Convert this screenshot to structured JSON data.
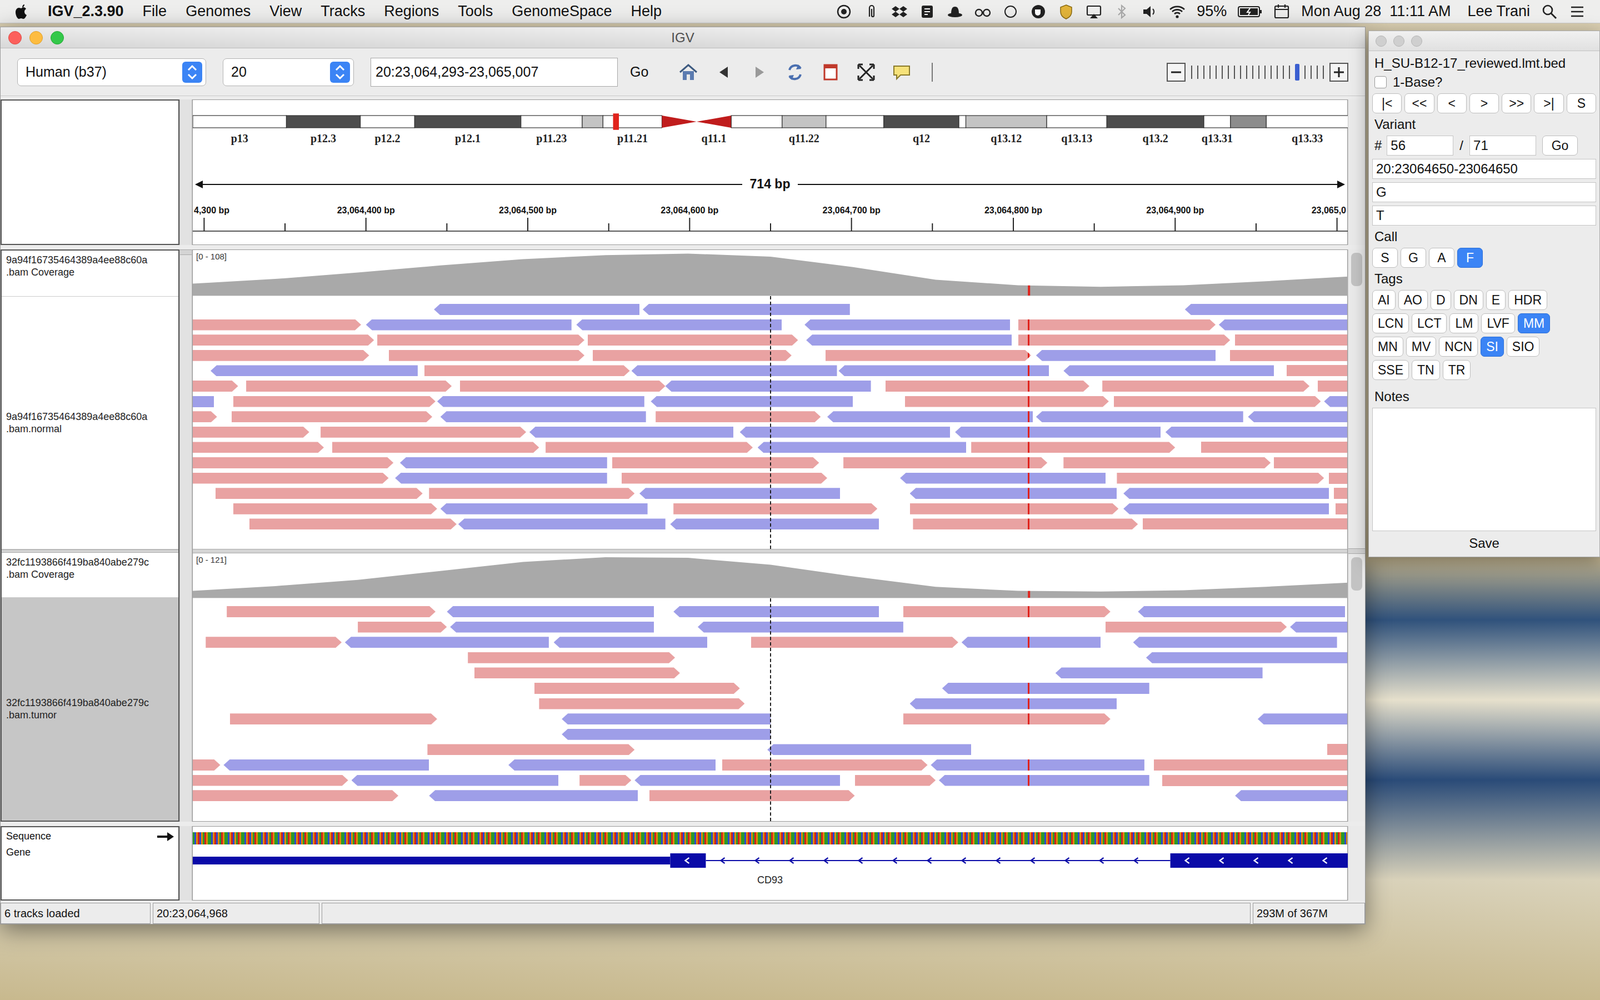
{
  "menubar": {
    "app": "IGV_2.3.90",
    "menus": [
      "File",
      "Genomes",
      "View",
      "Tracks",
      "Regions",
      "Tools",
      "GenomeSpace",
      "Help"
    ],
    "battery": "95%",
    "clock": "Mon Aug 28  11:11 AM",
    "user": "Lee Trani"
  },
  "window": {
    "title": "IGV"
  },
  "toolbar": {
    "genome": "Human (b37)",
    "chromosome": "20",
    "locus": "20:23,064,293-23,065,007",
    "go": "Go",
    "zoom": {
      "level": 0.8
    }
  },
  "ideogram": {
    "view_fraction": 0.366,
    "bands": [
      {
        "label": "p13",
        "stain": "gneg",
        "start": 0,
        "end": 0.081
      },
      {
        "label": "p12.3",
        "stain": "gpos75",
        "start": 0.081,
        "end": 0.145
      },
      {
        "label": "p12.2",
        "stain": "gneg",
        "start": 0.145,
        "end": 0.192
      },
      {
        "label": "p12.1",
        "stain": "gpos75",
        "start": 0.192,
        "end": 0.284
      },
      {
        "label": "p11.23",
        "stain": "gneg",
        "start": 0.284,
        "end": 0.337
      },
      {
        "stain": "gpos25",
        "start": 0.337,
        "end": 0.355
      },
      {
        "label": "p11.21",
        "stain": "gneg",
        "start": 0.355,
        "end": 0.406
      },
      {
        "stain": "acenp",
        "start": 0.406,
        "end": 0.436
      },
      {
        "label": "q11.1",
        "stain": "acenq",
        "start": 0.436,
        "end": 0.466
      },
      {
        "stain": "gneg",
        "start": 0.466,
        "end": 0.51
      },
      {
        "label": "q11.22",
        "stain": "gpos25",
        "start": 0.51,
        "end": 0.548
      },
      {
        "stain": "gneg",
        "start": 0.548,
        "end": 0.598
      },
      {
        "label": "q12",
        "stain": "gpos75",
        "start": 0.598,
        "end": 0.663
      },
      {
        "stain": "gneg",
        "start": 0.663,
        "end": 0.669
      },
      {
        "label": "q13.12",
        "stain": "gpos25",
        "start": 0.669,
        "end": 0.739
      },
      {
        "label": "q13.13",
        "stain": "gneg",
        "start": 0.739,
        "end": 0.791
      },
      {
        "label": "q13.2",
        "stain": "gpos75",
        "start": 0.791,
        "end": 0.875
      },
      {
        "label": "q13.31",
        "stain": "gneg",
        "start": 0.875,
        "end": 0.898
      },
      {
        "stain": "gpos50",
        "start": 0.898,
        "end": 0.929
      },
      {
        "label": "q13.33",
        "stain": "gneg",
        "start": 0.929,
        "end": 1
      }
    ]
  },
  "ruler": {
    "span": "714 bp",
    "ticks": [
      {
        "pos": 7,
        "label": "4,300 bp"
      },
      {
        "pos": 107,
        "label": "23,064,400 bp"
      },
      {
        "pos": 207,
        "label": "23,064,500 bp"
      },
      {
        "pos": 307,
        "label": "23,064,600 bp"
      },
      {
        "pos": 407,
        "label": "23,064,700 bp"
      },
      {
        "pos": 507,
        "label": "23,064,800 bp"
      },
      {
        "pos": 607,
        "label": "23,064,900 bp"
      },
      {
        "pos": 707,
        "label": "23,065,0"
      }
    ]
  },
  "view": {
    "length": 714
  },
  "tracks": [
    {
      "coverage_name": [
        "9a94f16735464389a4ee88c60a",
        ".bam Coverage"
      ],
      "reads_name": [
        "9a94f16735464389a4ee88c60a",
        ".bam.normal"
      ],
      "selected": false,
      "range": "[0 - 108]",
      "max": 108,
      "coverage": [
        30,
        42,
        58,
        76,
        92,
        102,
        106,
        98,
        72,
        40,
        26,
        22,
        26,
        36,
        48
      ],
      "rows": [
        [
          [
            149,
            276,
            "-"
          ],
          [
            278,
            406,
            "-"
          ],
          [
            613,
            714,
            "-"
          ]
        ],
        [
          [
            0,
            104,
            "+"
          ],
          [
            107,
            234,
            "-"
          ],
          [
            237,
            364,
            "-"
          ],
          [
            378,
            505,
            "-"
          ],
          [
            510,
            632,
            "+"
          ],
          [
            634,
            714,
            "-"
          ]
        ],
        [
          [
            0,
            112,
            "+"
          ],
          [
            114,
            242,
            "+"
          ],
          [
            244,
            374,
            "+"
          ],
          [
            379,
            506,
            "-"
          ],
          [
            510,
            641,
            "+"
          ],
          [
            644,
            714,
            "+"
          ]
        ],
        [
          [
            0,
            109,
            "+"
          ],
          [
            121,
            242,
            "+"
          ],
          [
            247,
            370,
            "+"
          ],
          [
            391,
            518,
            "+"
          ],
          [
            521,
            632,
            "-"
          ],
          [
            641,
            714,
            "+"
          ]
        ],
        [
          [
            11,
            139,
            "-"
          ],
          [
            143,
            270,
            "+"
          ],
          [
            271,
            398,
            "-"
          ],
          [
            399,
            529,
            "-"
          ],
          [
            538,
            668,
            "-"
          ],
          [
            676,
            714,
            "+"
          ]
        ],
        [
          [
            0,
            28,
            "+"
          ],
          [
            33,
            160,
            "+"
          ],
          [
            165,
            292,
            "+"
          ],
          [
            292,
            419,
            "-"
          ],
          [
            428,
            554,
            "+"
          ],
          [
            562,
            690,
            "+"
          ],
          [
            695,
            714,
            "+"
          ]
        ],
        [
          [
            0,
            13,
            "-"
          ],
          [
            25,
            150,
            "+"
          ],
          [
            151,
            279,
            "-"
          ],
          [
            283,
            408,
            "-"
          ],
          [
            440,
            566,
            "+"
          ],
          [
            569,
            697,
            "+"
          ],
          [
            699,
            714,
            "-"
          ]
        ],
        [
          [
            0,
            15,
            "+"
          ],
          [
            24,
            148,
            "+"
          ],
          [
            153,
            280,
            "-"
          ],
          [
            286,
            388,
            "+"
          ],
          [
            392,
            519,
            "-"
          ],
          [
            521,
            649,
            "-"
          ],
          [
            652,
            714,
            "-"
          ]
        ],
        [
          [
            0,
            72,
            "+"
          ],
          [
            79,
            206,
            "+"
          ],
          [
            208,
            334,
            "-"
          ],
          [
            338,
            468,
            "-"
          ],
          [
            471,
            598,
            "-"
          ],
          [
            601,
            714,
            "-"
          ]
        ],
        [
          [
            0,
            81,
            "+"
          ],
          [
            86,
            214,
            "+"
          ],
          [
            218,
            346,
            "+"
          ],
          [
            349,
            478,
            "-"
          ],
          [
            481,
            607,
            "+"
          ],
          [
            623,
            714,
            "+"
          ]
        ],
        [
          [
            0,
            124,
            "+"
          ],
          [
            128,
            256,
            "-"
          ],
          [
            259,
            387,
            "+"
          ],
          [
            402,
            528,
            "+"
          ],
          [
            538,
            666,
            "+"
          ],
          [
            668,
            714,
            "+"
          ]
        ],
        [
          [
            0,
            121,
            "+"
          ],
          [
            125,
            256,
            "-"
          ],
          [
            265,
            392,
            "+"
          ],
          [
            437,
            564,
            "-"
          ],
          [
            571,
            699,
            "+"
          ],
          [
            702,
            714,
            "+"
          ]
        ],
        [
          [
            14,
            142,
            "+"
          ],
          [
            146,
            273,
            "+"
          ],
          [
            276,
            400,
            "-"
          ],
          [
            443,
            571,
            "-"
          ],
          [
            575,
            702,
            "-"
          ],
          [
            705,
            714,
            "+"
          ]
        ],
        [
          [
            25,
            151,
            "+"
          ],
          [
            153,
            281,
            "-"
          ],
          [
            297,
            423,
            "+"
          ],
          [
            443,
            572,
            "+"
          ],
          [
            575,
            702,
            "-"
          ],
          [
            706,
            714,
            "+"
          ]
        ],
        [
          [
            35,
            163,
            "+"
          ],
          [
            164,
            292,
            "-"
          ],
          [
            295,
            424,
            "-"
          ],
          [
            445,
            584,
            "+"
          ],
          [
            587,
            714,
            "+"
          ]
        ]
      ]
    },
    {
      "coverage_name": [
        "32fc1193866f419ba840abe279c",
        ".bam Coverage"
      ],
      "reads_name": [
        "32fc1193866f419ba840abe279c",
        ".bam.tumor"
      ],
      "selected": true,
      "range": "[0 - 121]",
      "max": 121,
      "coverage": [
        20,
        34,
        52,
        78,
        104,
        118,
        116,
        96,
        62,
        32,
        20,
        18,
        22,
        32,
        44
      ],
      "rows": [
        [
          [
            21,
            150,
            "+"
          ],
          [
            157,
            285,
            "-"
          ],
          [
            297,
            424,
            "-"
          ],
          [
            439,
            567,
            "+"
          ],
          [
            584,
            712,
            "-"
          ]
        ],
        [
          [
            102,
            157,
            "+"
          ],
          [
            159,
            285,
            "-"
          ],
          [
            312,
            439,
            "-"
          ],
          [
            564,
            676,
            "+"
          ],
          [
            678,
            714,
            "-"
          ]
        ],
        [
          [
            8,
            92,
            "+"
          ],
          [
            94,
            220,
            "-"
          ],
          [
            223,
            318,
            "-"
          ],
          [
            345,
            473,
            "+"
          ],
          [
            475,
            561,
            "-"
          ],
          [
            581,
            707,
            "-"
          ]
        ],
        [
          [
            170,
            298,
            "+"
          ],
          [
            589,
            714,
            "-"
          ]
        ],
        [
          [
            174,
            301,
            "+"
          ],
          [
            533,
            661,
            "-"
          ]
        ],
        [
          [
            211,
            338,
            "+"
          ],
          [
            463,
            591,
            "-"
          ]
        ],
        [
          [
            214,
            341,
            "+"
          ],
          [
            443,
            571,
            "-"
          ]
        ],
        [
          [
            23,
            151,
            "+"
          ],
          [
            228,
            357,
            "-"
          ],
          [
            439,
            567,
            "+"
          ],
          [
            658,
            714,
            "-"
          ]
        ],
        [
          [
            228,
            357,
            "-"
          ]
        ],
        [
          [
            145,
            273,
            "+"
          ],
          [
            355,
            481,
            "-"
          ],
          [
            701,
            714,
            "+"
          ]
        ],
        [
          [
            0,
            17,
            "+"
          ],
          [
            19,
            146,
            "-"
          ],
          [
            195,
            323,
            "-"
          ],
          [
            327,
            454,
            "+"
          ],
          [
            456,
            588,
            "-"
          ],
          [
            594,
            714,
            "+"
          ]
        ],
        [
          [
            0,
            96,
            "+"
          ],
          [
            98,
            226,
            "-"
          ],
          [
            239,
            271,
            "+"
          ],
          [
            273,
            400,
            "-"
          ],
          [
            409,
            459,
            "+"
          ],
          [
            461,
            591,
            "-"
          ],
          [
            599,
            714,
            "+"
          ]
        ],
        [
          [
            0,
            127,
            "+"
          ],
          [
            146,
            275,
            "-"
          ],
          [
            282,
            409,
            "+"
          ],
          [
            644,
            714,
            "-"
          ]
        ]
      ]
    }
  ],
  "mismatches": [
    {
      "pos": 516,
      "color": "#e0231c"
    }
  ],
  "lower": {
    "sequence_label": "Sequence",
    "gene_label": "Gene"
  },
  "gene": {
    "name": "CD93",
    "strand": "-",
    "features": [
      {
        "kind": "utr",
        "start": 0,
        "end": 295
      },
      {
        "kind": "exon",
        "start": 295,
        "end": 317
      },
      {
        "kind": "intron",
        "start": 317,
        "end": 604
      },
      {
        "kind": "exon",
        "start": 604,
        "end": 714
      }
    ]
  },
  "status_bar": {
    "tracks": "6 tracks loaded",
    "position": "20:23,064,968",
    "memory": "293M of 367M"
  },
  "panel": {
    "file": "H_SU-B12-17_reviewed.lmt.bed",
    "one_base": {
      "label": "1-Base?",
      "checked": false
    },
    "nav": [
      "|<",
      "<<",
      "<",
      ">",
      ">>",
      ">|",
      "S"
    ],
    "variant_label": "Variant",
    "hash": "#",
    "index": "56",
    "slash": "/",
    "total": "71",
    "go": "Go",
    "position": "20:23064650-23064650",
    "ref": "G",
    "alt": "T",
    "call_label": "Call",
    "calls": [
      {
        "label": "S",
        "selected": false
      },
      {
        "label": "G",
        "selected": false
      },
      {
        "label": "A",
        "selected": false
      },
      {
        "label": "F",
        "selected": true
      }
    ],
    "tags_label": "Tags",
    "tag_rows": [
      [
        {
          "label": "AI",
          "selected": false
        },
        {
          "label": "AO",
          "selected": false
        },
        {
          "label": "D",
          "selected": false
        },
        {
          "label": "DN",
          "selected": false
        },
        {
          "label": "E",
          "selected": false
        },
        {
          "label": "HDR",
          "selected": false
        }
      ],
      [
        {
          "label": "LCN",
          "selected": false
        },
        {
          "label": "LCT",
          "selected": false
        },
        {
          "label": "LM",
          "selected": false
        },
        {
          "label": "LVF",
          "selected": false
        },
        {
          "label": "MM",
          "selected": true
        }
      ],
      [
        {
          "label": "MN",
          "selected": false
        },
        {
          "label": "MV",
          "selected": false
        },
        {
          "label": "NCN",
          "selected": false
        },
        {
          "label": "SI",
          "selected": true
        },
        {
          "label": "SIO",
          "selected": false
        }
      ],
      [
        {
          "label": "SSE",
          "selected": false
        },
        {
          "label": "TN",
          "selected": false
        },
        {
          "label": "TR",
          "selected": false
        }
      ]
    ],
    "notes_label": "Notes",
    "save": "Save"
  }
}
